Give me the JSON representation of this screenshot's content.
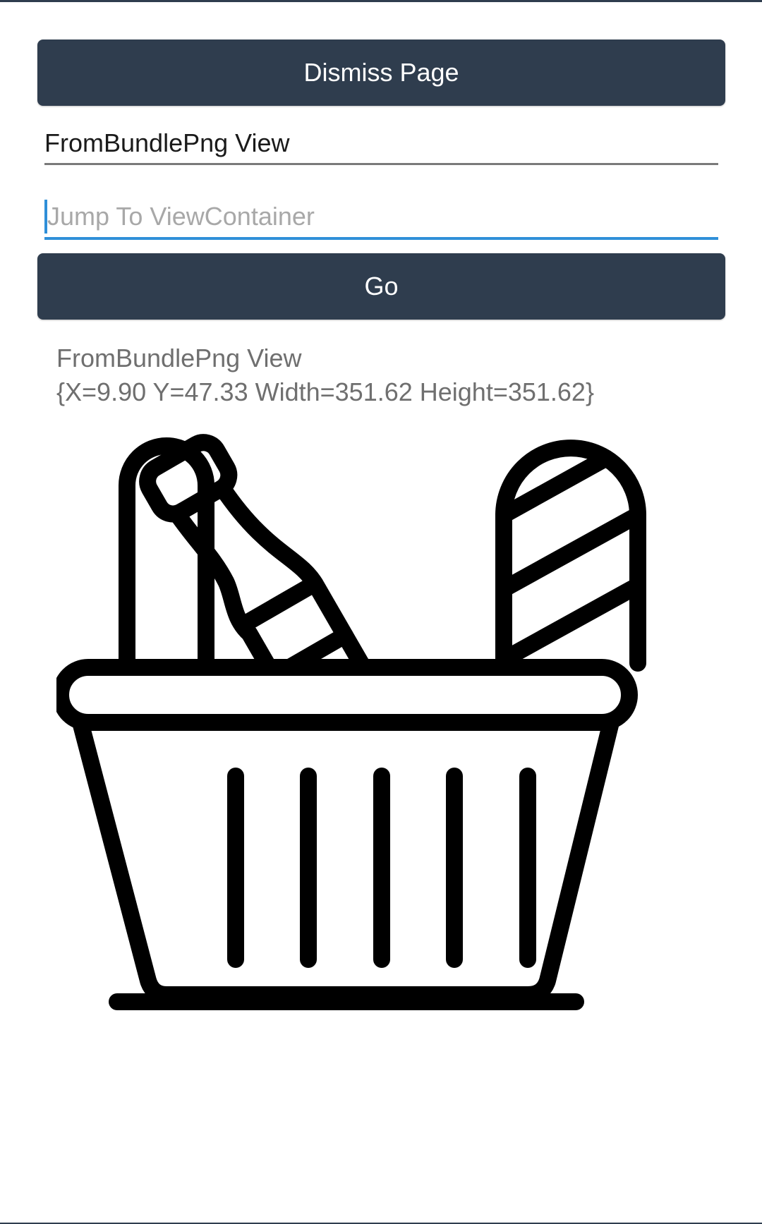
{
  "buttons": {
    "dismiss_label": "Dismiss Page",
    "go_label": "Go"
  },
  "title_field": {
    "value": "FromBundlePng View"
  },
  "jump_field": {
    "placeholder": "Jump To ViewContainer",
    "value": ""
  },
  "info": {
    "view_name": "FromBundlePng View",
    "frame_text": "{X=9.90 Y=47.33 Width=351.62 Height=351.62}"
  },
  "image": {
    "icon": "grocery-basket-icon"
  },
  "colors": {
    "button_bg": "#2f3d4e",
    "button_text": "#ffffff",
    "focus_accent": "#2f8fd8",
    "muted_text": "#6f6f6f"
  }
}
